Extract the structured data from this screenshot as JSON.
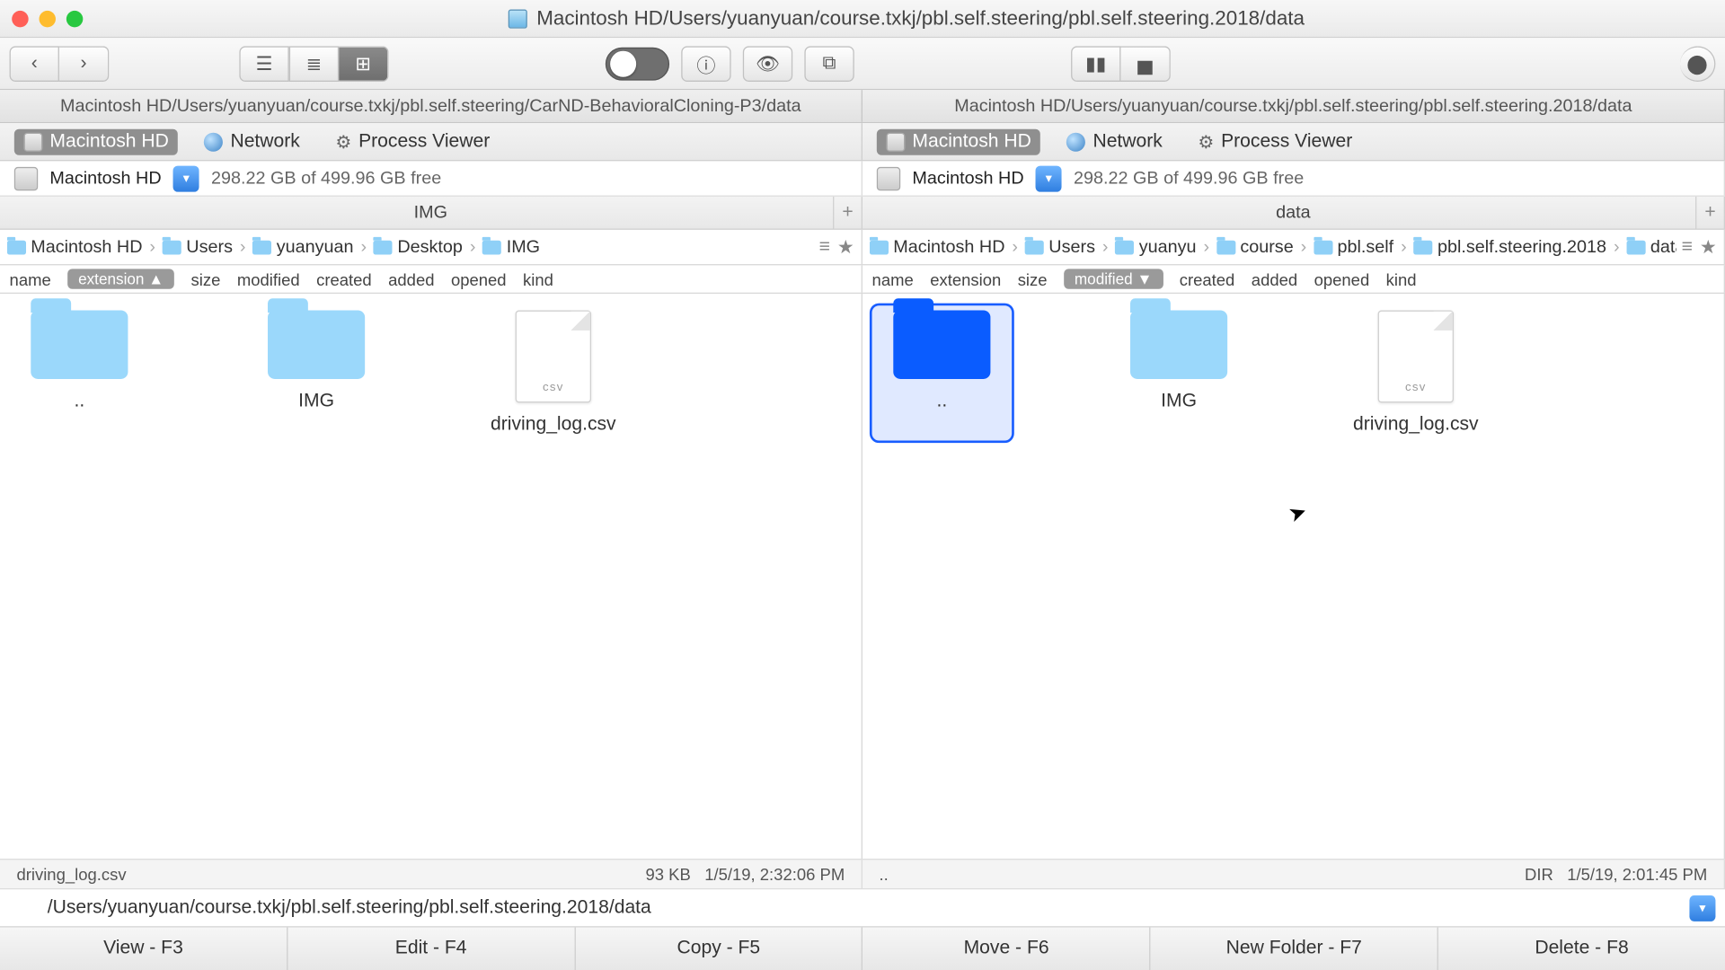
{
  "window": {
    "title": "Macintosh HD/Users/yuanyuan/course.txkj/pbl.self.steering/pbl.self.steering.2018/data"
  },
  "toolbar": {
    "back": "‹",
    "forward": "›"
  },
  "path_tabs": {
    "left": "Macintosh HD/Users/yuanyuan/course.txkj/pbl.self.steering/CarND-BehavioralCloning-P3/data",
    "right": "Macintosh HD/Users/yuanyuan/course.txkj/pbl.self.steering/pbl.self.steering.2018/data"
  },
  "shelf": {
    "hd": "Macintosh HD",
    "network": "Network",
    "process": "Process Viewer"
  },
  "drive": {
    "name": "Macintosh HD",
    "free": "298.22 GB of 499.96 GB free"
  },
  "folder_tabs": {
    "left": "IMG",
    "right": "data"
  },
  "breadcrumbs": {
    "left": [
      "Macintosh HD",
      "Users",
      "yuanyuan",
      "Desktop",
      "IMG"
    ],
    "right": [
      "Macintosh HD",
      "Users",
      "yuanyu",
      "course",
      "pbl.self",
      "pbl.self.steering.2018",
      "data"
    ]
  },
  "columns": {
    "left": {
      "list": [
        "name",
        "extension",
        "size",
        "modified",
        "created",
        "added",
        "opened",
        "kind"
      ],
      "sorted": "extension",
      "dir": "▲"
    },
    "right": {
      "list": [
        "name",
        "extension",
        "size",
        "modified",
        "created",
        "added",
        "opened",
        "kind"
      ],
      "sorted": "modified",
      "dir": "▼"
    }
  },
  "left_items": [
    {
      "name": "..",
      "type": "folder"
    },
    {
      "name": "IMG",
      "type": "folder"
    },
    {
      "name": "driving_log.csv",
      "type": "csv"
    }
  ],
  "right_items": [
    {
      "name": "..",
      "type": "folder",
      "selected": true
    },
    {
      "name": "IMG",
      "type": "folder"
    },
    {
      "name": "driving_log.csv",
      "type": "csv"
    }
  ],
  "status": {
    "left": {
      "name": "driving_log.csv",
      "size": "93 KB",
      "date": "1/5/19, 2:32:06 PM"
    },
    "right": {
      "name": "..",
      "size": "DIR",
      "date": "1/5/19, 2:01:45 PM"
    }
  },
  "cmdline": "/Users/yuanyuan/course.txkj/pbl.self.steering/pbl.self.steering.2018/data",
  "fkeys": [
    "View - F3",
    "Edit - F4",
    "Copy - F5",
    "Move - F6",
    "New Folder - F7",
    "Delete - F8"
  ]
}
